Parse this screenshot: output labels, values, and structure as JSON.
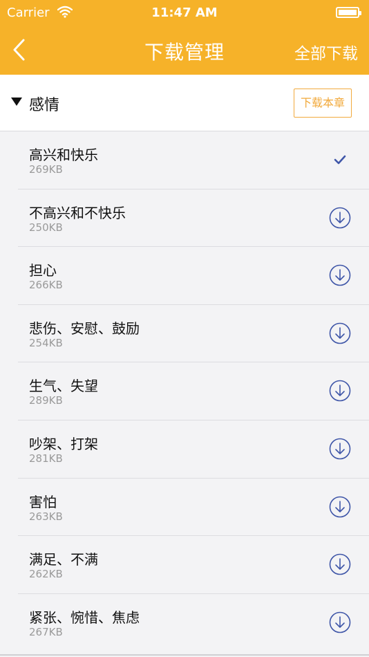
{
  "status_bar": {
    "carrier": "Carrier",
    "time": "11:47 AM",
    "icons": [
      "wifi-icon",
      "battery-icon"
    ]
  },
  "nav": {
    "back_icon": "chevron-left-icon",
    "title": "下载管理",
    "download_all": "全部下载"
  },
  "section": {
    "title": "感情",
    "caret_icon": "triangle-down-icon",
    "download_chapter": "下载本章"
  },
  "items": [
    {
      "name": "高兴和快乐",
      "size": "269KB",
      "status": "downloaded"
    },
    {
      "name": "不高兴和不快乐",
      "size": "250KB",
      "status": "download"
    },
    {
      "name": "担心",
      "size": "266KB",
      "status": "download"
    },
    {
      "name": "悲伤、安慰、鼓励",
      "size": "254KB",
      "status": "download"
    },
    {
      "name": "生气、失望",
      "size": "289KB",
      "status": "download"
    },
    {
      "name": "吵架、打架",
      "size": "281KB",
      "status": "download"
    },
    {
      "name": "害怕",
      "size": "263KB",
      "status": "download"
    },
    {
      "name": "满足、不满",
      "size": "262KB",
      "status": "download"
    },
    {
      "name": "紧张、惋惜、焦虑",
      "size": "267KB",
      "status": "download"
    }
  ],
  "colors": {
    "accent": "#f6b229",
    "chapter_button": "#f2a93b",
    "status_icon": "#3f56a8"
  }
}
